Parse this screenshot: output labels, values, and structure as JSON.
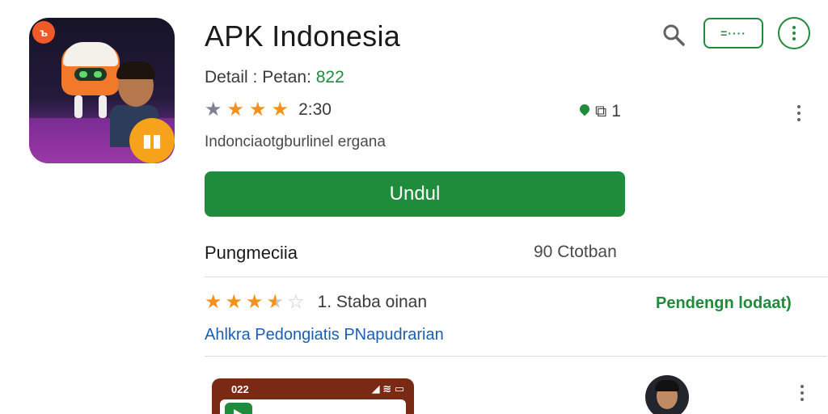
{
  "app": {
    "title": "APK Indonesia",
    "detail_label": "Detail : Petan:",
    "detail_value": "822",
    "rating_value": "2:30",
    "meta_count": "1",
    "tagline": "Indonciaotgburlinel ergana",
    "install_label": "Undul",
    "icon_badge_top": "ъ",
    "icon_badge_bottom": "▮▮"
  },
  "toolbar": {
    "toggle_label": "=····"
  },
  "ratings_section": {
    "title": "Pungmeciia",
    "count": "90 Ctotban",
    "summary": "1. Staba oinan",
    "review_link": "Pendengn lodaat)",
    "blue_link": "Ahlkra Pedongiatis PNapudrarian",
    "stars_filled": 3.5,
    "stars_total": 5
  },
  "preview": {
    "status_time": "022",
    "status_icons": "◢ ≋ ▭"
  },
  "colors": {
    "accent": "#1e8c3a",
    "star": "#f2911b",
    "link": "#1a5fb4"
  },
  "icons": [
    "search-icon",
    "menu-icon",
    "more-vert-icon",
    "star-icon",
    "location-pin-icon",
    "play-store-icon"
  ]
}
